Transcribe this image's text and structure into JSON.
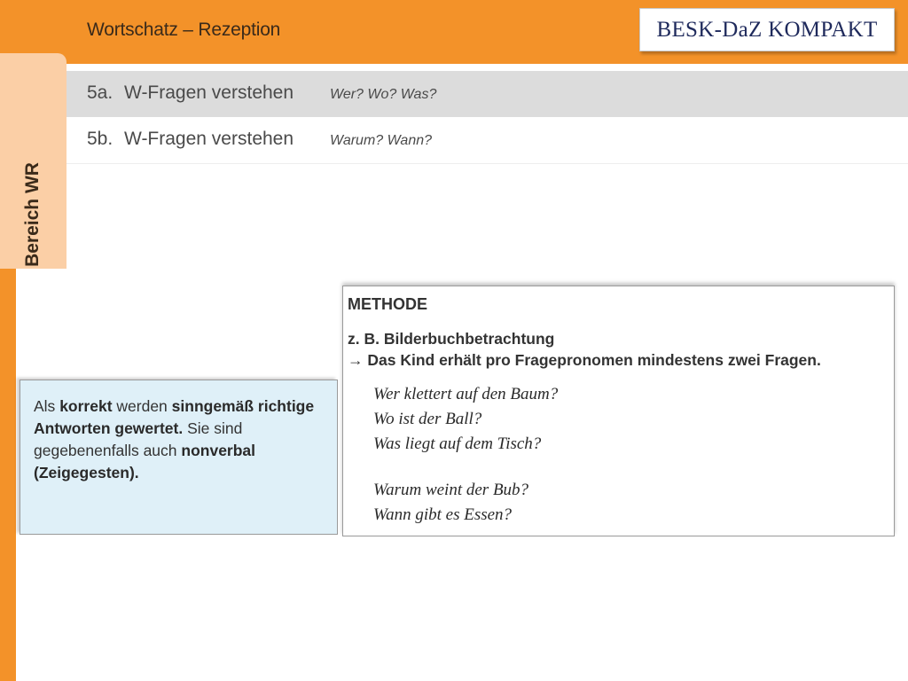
{
  "header": {
    "title": "Wortschatz – Rezeption",
    "logo_text": "BESK-DaZ KOMPAKT"
  },
  "side_tab": {
    "label": "Bereich WR"
  },
  "rows": [
    {
      "num": "5a.",
      "title": "W-Fragen verstehen",
      "sub": "Wer?  Wo?  Was?"
    },
    {
      "num": "5b.",
      "title": "W-Fragen verstehen",
      "sub": "Warum?  Wann?"
    }
  ],
  "info": {
    "t1": "Als ",
    "b1": "korrekt",
    "t2": " werden ",
    "b2": "sinngemäß richtige Antworten gewertet.",
    "t3": " Sie sind gegebenenfalls auch ",
    "b3": "nonverbal (Zeigegesten)."
  },
  "method": {
    "heading": "METHODE",
    "line1": "z. B. Bilderbuchbetrachtung",
    "line2": "→ Das Kind erhält pro Fragepronomen mindestens zwei Fragen.",
    "questions": [
      "Wer klettert auf den Baum?",
      "Wo ist der Ball?",
      "Was liegt auf dem Tisch?",
      "Warum weint der Bub?",
      "Wann gibt es Essen?"
    ]
  },
  "colors": {
    "accent_orange": "#f39229",
    "tab_peach": "#fbcfa6",
    "info_blue": "#dff0f8",
    "logo_navy": "#1f2a5c"
  }
}
